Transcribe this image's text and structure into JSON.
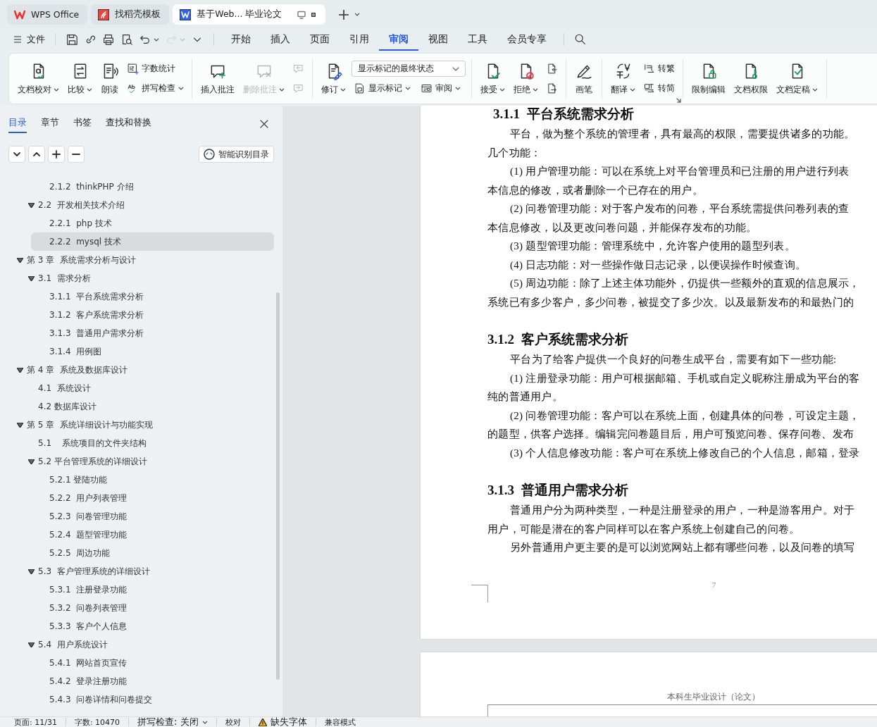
{
  "tab_bar": {
    "tabs": [
      {
        "label": "WPS Office",
        "selected": false
      },
      {
        "label": "找稻壳模板",
        "selected": false
      },
      {
        "label": "基于Web... 毕业论文",
        "selected": true
      }
    ]
  },
  "menu_bar": {
    "file_label": "文件",
    "quick_access": [
      {
        "disabled": false,
        "caret": false
      },
      {
        "disabled": false,
        "caret": false
      },
      {
        "disabled": false,
        "caret": false
      },
      {
        "disabled": false,
        "caret": false
      },
      {
        "disabled": false,
        "caret": true
      },
      {
        "disabled": true,
        "caret": true
      },
      {
        "disabled": false,
        "caret": false
      }
    ],
    "tabs": [
      {
        "label": "开始",
        "selected": false
      },
      {
        "label": "插入",
        "selected": false
      },
      {
        "label": "页面",
        "selected": false
      },
      {
        "label": "引用",
        "selected": false
      },
      {
        "label": "审阅",
        "selected": true
      },
      {
        "label": "视图",
        "selected": false
      },
      {
        "label": "工具",
        "selected": false
      },
      {
        "label": "会员专享",
        "selected": false
      }
    ]
  },
  "ribbon": {
    "groups": [
      {
        "items": [
          {
            "kind": "large",
            "label": "文档校对",
            "caret": true,
            "disabled": false
          },
          {
            "kind": "large",
            "label": "比较",
            "caret": true,
            "disabled": false
          },
          {
            "kind": "large",
            "label": "朗读",
            "caret": false,
            "disabled": false
          },
          {
            "kind": "stack",
            "items": [
              {
                "label": "字数统计",
                "caret": false,
                "disabled": false
              },
              {
                "label": "拼写检查",
                "caret": true,
                "disabled": false
              }
            ]
          }
        ]
      },
      {
        "items": [
          {
            "kind": "large",
            "label": "插入批注",
            "caret": false,
            "disabled": false
          },
          {
            "kind": "large",
            "label": "删除批注",
            "caret": true,
            "disabled": true
          },
          {
            "kind": "stack",
            "items": [
              {
                "caret": false,
                "disabled": true
              },
              {
                "caret": false,
                "disabled": true
              }
            ]
          }
        ]
      },
      {
        "items": [
          {
            "kind": "large",
            "label": "修订",
            "caret": true,
            "disabled": false
          },
          {
            "kind": "select",
            "value": "显示标记的最终状态",
            "items": [
              {
                "label": "显示标记",
                "caret": true,
                "disabled": false
              },
              {
                "label": "审阅",
                "caret": true,
                "disabled": false
              }
            ]
          }
        ]
      },
      {
        "items": [
          {
            "kind": "large",
            "label": "接受",
            "caret": true,
            "disabled": false
          },
          {
            "kind": "large",
            "label": "拒绝",
            "caret": true,
            "disabled": false
          },
          {
            "kind": "stack",
            "items": [
              {
                "caret": false,
                "disabled": false
              },
              {
                "caret": false,
                "disabled": false
              }
            ]
          }
        ]
      },
      {
        "items": [
          {
            "kind": "large",
            "label": "画笔",
            "caret": false,
            "disabled": false
          }
        ]
      },
      {
        "launcher": true,
        "items": [
          {
            "kind": "large",
            "label": "翻译",
            "caret": true,
            "disabled": false
          },
          {
            "kind": "stack",
            "items": [
              {
                "label": "转繁",
                "caret": false,
                "disabled": false
              },
              {
                "label": "转简",
                "caret": false,
                "disabled": false
              }
            ]
          }
        ]
      },
      {
        "items": [
          {
            "kind": "large",
            "label": "限制编辑",
            "caret": false,
            "disabled": false
          },
          {
            "kind": "large",
            "label": "文档权限",
            "caret": false,
            "disabled": false
          },
          {
            "kind": "large",
            "label": "文档定稿",
            "caret": true,
            "disabled": false
          }
        ]
      }
    ]
  },
  "nav_panel": {
    "tabs": [
      {
        "label": "目录",
        "selected": true
      },
      {
        "label": "章节",
        "selected": false
      },
      {
        "label": "书签",
        "selected": false
      },
      {
        "label": "查找和替换",
        "selected": false
      }
    ],
    "smart_button": "智能识别目录",
    "toc": [
      {
        "children": [
          {
            "children": [
              {
                "label": "2.1.2  thinkPHP 介绍",
                "selected": false
              }
            ]
          },
          {
            "label": "2.2  开发相关技术介绍",
            "expanded": true,
            "selected": false,
            "children": [
              {
                "label": "2.2.1  php 技术",
                "selected": false
              },
              {
                "label": "2.2.2  mysql 技术",
                "selected": true
              }
            ]
          }
        ]
      },
      {
        "label": "第 3 章  系统需求分析与设计",
        "expanded": true,
        "selected": false,
        "children": [
          {
            "label": "3.1  需求分析",
            "expanded": true,
            "selected": false,
            "children": [
              {
                "label": "3.1.1  平台系统需求分析",
                "selected": false
              },
              {
                "label": "3.1.2  客户系统需求分析",
                "selected": false
              },
              {
                "label": "3.1.3  普通用户需求分析",
                "selected": false
              },
              {
                "label": "3.1.4  用例图",
                "selected": false
              }
            ]
          }
        ]
      },
      {
        "label": "第 4 章  系统及数据库设计",
        "expanded": true,
        "selected": false,
        "children": [
          {
            "label": "4.1  系统设计",
            "selected": false
          },
          {
            "label": "4.2 数据库设计",
            "selected": false
          }
        ]
      },
      {
        "label": "第 5 章  系统详细设计与功能实现",
        "expanded": true,
        "selected": false,
        "children": [
          {
            "label": "5.1    系统项目的文件夹结构",
            "selected": false
          },
          {
            "label": "5.2 平台管理系统的详细设计",
            "expanded": true,
            "selected": false,
            "children": [
              {
                "label": "5.2.1 登陆功能",
                "selected": false
              },
              {
                "label": "5.2.2  用户列表管理",
                "selected": false
              },
              {
                "label": "5.2.3  问卷管理功能",
                "selected": false
              },
              {
                "label": "5.2.4  题型管理功能",
                "selected": false
              },
              {
                "label": "5.2.5  周边功能",
                "selected": false
              }
            ]
          },
          {
            "label": "5.3  客户管理系统的详细设计",
            "expanded": true,
            "selected": false,
            "children": [
              {
                "label": "5.3.1  注册登录功能",
                "selected": false
              },
              {
                "label": "5.3.2  问卷列表管理",
                "selected": false
              },
              {
                "label": "5.3.3  客户个人信息",
                "selected": false
              }
            ]
          },
          {
            "label": "5.4  用户系统设计",
            "expanded": true,
            "selected": false,
            "children": [
              {
                "label": "5.4.1  网站首页宣传",
                "selected": false
              },
              {
                "label": "5.4.2  登录注册功能",
                "selected": false
              },
              {
                "label": "5.4.3  问卷详情和问卷提交",
                "selected": false
              }
            ]
          }
        ]
      }
    ]
  },
  "document": {
    "pages": [
      {
        "blocks": [
          {
            "kind": "heading",
            "text": "3.1.1  平台系统需求分析"
          },
          {
            "kind": "para",
            "lines": [
              "平台，做为整个系统的管理者，具有最高的权限，需要提供诸多的功能。",
              "几个功能："
            ]
          },
          {
            "kind": "para",
            "lines": [
              "(1) 用户管理功能：可以在系统上对平台管理员和已注册的用户进行列表",
              "本信息的修改，或者删除一个已存在的用户。"
            ]
          },
          {
            "kind": "para",
            "lines": [
              "(2) 问卷管理功能：对于客户发布的问卷，平台系统需提供问卷列表的查",
              "本信息修改，以及更改问卷问题，并能保存发布的功能。"
            ]
          },
          {
            "kind": "para",
            "lines": [
              "(3) 题型管理功能：管理系统中，允许客户使用的题型列表。"
            ]
          },
          {
            "kind": "para",
            "lines": [
              "(4) 日志功能：对一些操作做日志记录，以便误操作时候查询。"
            ]
          },
          {
            "kind": "para",
            "lines": [
              "(5) 周边功能：除了上述主体功能外，仍提供一些额外的直观的信息展示，",
              "系统已有多少客户，多少问卷，被提交了多少次。以及最新发布的和最热门的"
            ]
          },
          {
            "kind": "heading",
            "text": "3.1.2  客户系统需求分析"
          },
          {
            "kind": "para",
            "lines": [
              "平台为了给客户提供一个良好的问卷生成平台，需要有如下一些功能:"
            ]
          },
          {
            "kind": "para",
            "lines": [
              "(1) 注册登录功能：用户可根据邮箱、手机或自定义昵称注册成为平台的客",
              "纯的普通用户。"
            ]
          },
          {
            "kind": "para",
            "lines": [
              "(2) 问卷管理功能：客户可以在系统上面，创建具体的问卷，可设定主题，",
              "的题型，供客户选择。编辑完问卷题目后，用户可预览问卷、保存问卷、发布"
            ]
          },
          {
            "kind": "para",
            "lines": [
              "(3) 个人信息修改功能：客户可在系统上修改自己的个人信息，邮箱，登录"
            ]
          },
          {
            "kind": "heading",
            "text": "3.1.3  普通用户需求分析"
          },
          {
            "kind": "para",
            "lines": [
              "普通用户分为两种类型，一种是注册登录的用户，一种是游客用户。对于",
              "用户，可能是潜在的客户同样可以在客户系统上创建自己的问卷。"
            ]
          },
          {
            "kind": "para",
            "lines": [
              "另外普通用户更主要的是可以浏览网站上都有哪些问卷，以及问卷的填写"
            ]
          }
        ],
        "page_number": "7"
      },
      {
        "header": "本科生毕业设计（论文）"
      }
    ]
  },
  "status_bar": {
    "items": [
      {
        "kind": "text",
        "text": "页面: 11/31"
      },
      {
        "kind": "text",
        "text": "字数: 10470"
      },
      {
        "kind": "dropdown",
        "text": "拼写检查: 关闭"
      },
      {
        "kind": "text",
        "text": "校对"
      },
      {
        "kind": "warning",
        "text": "缺失字体"
      },
      {
        "kind": "text",
        "text": "兼容模式"
      }
    ]
  }
}
